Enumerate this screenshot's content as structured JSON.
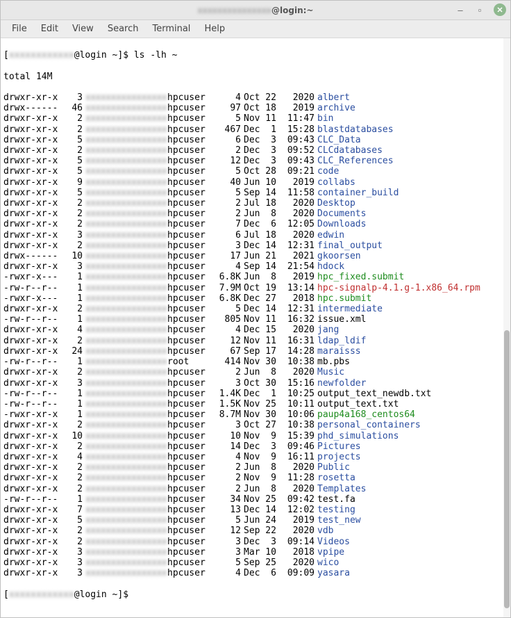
{
  "window": {
    "title_blurred": "xxxxxxxxxxxxxxx",
    "title_clear": "@login:~"
  },
  "menubar": [
    "File",
    "Edit",
    "View",
    "Search",
    "Terminal",
    "Help"
  ],
  "prompt": {
    "open": "[",
    "user_blurred": "xxxxxxxxxxxx",
    "host": "@login ~]$ ",
    "command": "ls -lh ~"
  },
  "total_line": "total 14M",
  "owner_placeholder": "xxxxxxxxxxxxxxxx",
  "listing": [
    {
      "perms": "drwxr-xr-x",
      "links": "3",
      "group": "hpcuser",
      "size": "4",
      "date": "Oct 22",
      "time": "2020",
      "name": "albert",
      "cls": "c-dir"
    },
    {
      "perms": "drwx------",
      "links": "46",
      "group": "hpcuser",
      "size": "97",
      "date": "Oct 18",
      "time": "2019",
      "name": "archive",
      "cls": "c-dir"
    },
    {
      "perms": "drwxr-xr-x",
      "links": "2",
      "group": "hpcuser",
      "size": "5",
      "date": "Nov 11",
      "time": "11:47",
      "name": "bin",
      "cls": "c-dir"
    },
    {
      "perms": "drwxr-xr-x",
      "links": "2",
      "group": "hpcuser",
      "size": "467",
      "date": "Dec  1",
      "time": "15:28",
      "name": "blastdatabases",
      "cls": "c-dir"
    },
    {
      "perms": "drwxr-xr-x",
      "links": "5",
      "group": "hpcuser",
      "size": "6",
      "date": "Dec  3",
      "time": "09:43",
      "name": "CLC_Data",
      "cls": "c-dir"
    },
    {
      "perms": "drwxr-xr-x",
      "links": "2",
      "group": "hpcuser",
      "size": "2",
      "date": "Dec  3",
      "time": "09:52",
      "name": "CLCdatabases",
      "cls": "c-dir"
    },
    {
      "perms": "drwxr-xr-x",
      "links": "5",
      "group": "hpcuser",
      "size": "12",
      "date": "Dec  3",
      "time": "09:43",
      "name": "CLC_References",
      "cls": "c-dir"
    },
    {
      "perms": "drwxr-xr-x",
      "links": "5",
      "group": "hpcuser",
      "size": "5",
      "date": "Oct 28",
      "time": "09:21",
      "name": "code",
      "cls": "c-dir"
    },
    {
      "perms": "drwxr-xr-x",
      "links": "9",
      "group": "hpcuser",
      "size": "40",
      "date": "Jun 10",
      "time": "2019",
      "name": "collabs",
      "cls": "c-dir"
    },
    {
      "perms": "drwxr-xr-x",
      "links": "5",
      "group": "hpcuser",
      "size": "5",
      "date": "Sep 14",
      "time": "11:58",
      "name": "container_build",
      "cls": "c-dir"
    },
    {
      "perms": "drwxr-xr-x",
      "links": "2",
      "group": "hpcuser",
      "size": "2",
      "date": "Jul 18",
      "time": "2020",
      "name": "Desktop",
      "cls": "c-dir"
    },
    {
      "perms": "drwxr-xr-x",
      "links": "2",
      "group": "hpcuser",
      "size": "2",
      "date": "Jun  8",
      "time": "2020",
      "name": "Documents",
      "cls": "c-dir"
    },
    {
      "perms": "drwxr-xr-x",
      "links": "2",
      "group": "hpcuser",
      "size": "7",
      "date": "Dec  6",
      "time": "12:05",
      "name": "Downloads",
      "cls": "c-dir"
    },
    {
      "perms": "drwxr-xr-x",
      "links": "3",
      "group": "hpcuser",
      "size": "6",
      "date": "Jul 18",
      "time": "2020",
      "name": "edwin",
      "cls": "c-dir"
    },
    {
      "perms": "drwxr-xr-x",
      "links": "2",
      "group": "hpcuser",
      "size": "3",
      "date": "Dec 14",
      "time": "12:31",
      "name": "final_output",
      "cls": "c-dir"
    },
    {
      "perms": "drwx------",
      "links": "10",
      "group": "hpcuser",
      "size": "17",
      "date": "Jun 21",
      "time": "2021",
      "name": "gkoorsen",
      "cls": "c-dir"
    },
    {
      "perms": "drwxr-xr-x",
      "links": "3",
      "group": "hpcuser",
      "size": "4",
      "date": "Sep 14",
      "time": "21:54",
      "name": "hdock",
      "cls": "c-dir"
    },
    {
      "perms": "-rwxr-x---",
      "links": "1",
      "group": "hpcuser",
      "size": "6.8K",
      "date": "Jun  8",
      "time": "2019",
      "name": "hpc_fixed.submit",
      "cls": "c-exec"
    },
    {
      "perms": "-rw-r--r--",
      "links": "1",
      "group": "hpcuser",
      "size": "7.9M",
      "date": "Oct 19",
      "time": "13:14",
      "name": "hpc-signalp-4.1.g-1.x86_64.rpm",
      "cls": "c-arch"
    },
    {
      "perms": "-rwxr-x---",
      "links": "1",
      "group": "hpcuser",
      "size": "6.8K",
      "date": "Dec 27",
      "time": "2018",
      "name": "hpc.submit",
      "cls": "c-exec"
    },
    {
      "perms": "drwxr-xr-x",
      "links": "2",
      "group": "hpcuser",
      "size": "5",
      "date": "Dec 14",
      "time": "12:31",
      "name": "intermediate",
      "cls": "c-dir"
    },
    {
      "perms": "-rw-r--r--",
      "links": "1",
      "group": "hpcuser",
      "size": "805",
      "date": "Nov 11",
      "time": "16:32",
      "name": "issue.xml",
      "cls": "c-plain"
    },
    {
      "perms": "drwxr-xr-x",
      "links": "4",
      "group": "hpcuser",
      "size": "4",
      "date": "Dec 15",
      "time": "2020",
      "name": "jang",
      "cls": "c-dir"
    },
    {
      "perms": "drwxr-xr-x",
      "links": "2",
      "group": "hpcuser",
      "size": "12",
      "date": "Nov 11",
      "time": "16:31",
      "name": "ldap_ldif",
      "cls": "c-dir"
    },
    {
      "perms": "drwxr-xr-x",
      "links": "24",
      "group": "hpcuser",
      "size": "67",
      "date": "Sep 17",
      "time": "14:28",
      "name": "maraisss",
      "cls": "c-dir"
    },
    {
      "perms": "-rw-r--r--",
      "links": "1",
      "group": "root",
      "size": "414",
      "date": "Nov 30",
      "time": "10:38",
      "name": "mb.pbs",
      "cls": "c-plain"
    },
    {
      "perms": "drwxr-xr-x",
      "links": "2",
      "group": "hpcuser",
      "size": "2",
      "date": "Jun  8",
      "time": "2020",
      "name": "Music",
      "cls": "c-dir"
    },
    {
      "perms": "drwxr-xr-x",
      "links": "3",
      "group": "hpcuser",
      "size": "3",
      "date": "Oct 30",
      "time": "15:16",
      "name": "newfolder",
      "cls": "c-dir"
    },
    {
      "perms": "-rw-r--r--",
      "links": "1",
      "group": "hpcuser",
      "size": "1.4K",
      "date": "Dec  1",
      "time": "10:25",
      "name": "output_text_newdb.txt",
      "cls": "c-plain"
    },
    {
      "perms": "-rw-r--r--",
      "links": "1",
      "group": "hpcuser",
      "size": "1.5K",
      "date": "Nov 25",
      "time": "10:11",
      "name": "output_text.txt",
      "cls": "c-plain"
    },
    {
      "perms": "-rwxr-xr-x",
      "links": "1",
      "group": "hpcuser",
      "size": "8.7M",
      "date": "Nov 30",
      "time": "10:06",
      "name": "paup4a168_centos64",
      "cls": "c-exec"
    },
    {
      "perms": "drwxr-xr-x",
      "links": "2",
      "group": "hpcuser",
      "size": "3",
      "date": "Oct 27",
      "time": "10:38",
      "name": "personal_containers",
      "cls": "c-dir"
    },
    {
      "perms": "drwxr-xr-x",
      "links": "10",
      "group": "hpcuser",
      "size": "10",
      "date": "Nov  9",
      "time": "15:39",
      "name": "phd_simulations",
      "cls": "c-dir"
    },
    {
      "perms": "drwxr-xr-x",
      "links": "2",
      "group": "hpcuser",
      "size": "14",
      "date": "Dec  3",
      "time": "09:46",
      "name": "Pictures",
      "cls": "c-dir"
    },
    {
      "perms": "drwxr-xr-x",
      "links": "4",
      "group": "hpcuser",
      "size": "4",
      "date": "Nov  9",
      "time": "16:11",
      "name": "projects",
      "cls": "c-dir"
    },
    {
      "perms": "drwxr-xr-x",
      "links": "2",
      "group": "hpcuser",
      "size": "2",
      "date": "Jun  8",
      "time": "2020",
      "name": "Public",
      "cls": "c-dir"
    },
    {
      "perms": "drwxr-xr-x",
      "links": "2",
      "group": "hpcuser",
      "size": "2",
      "date": "Nov  9",
      "time": "11:28",
      "name": "rosetta",
      "cls": "c-dir"
    },
    {
      "perms": "drwxr-xr-x",
      "links": "2",
      "group": "hpcuser",
      "size": "2",
      "date": "Jun  8",
      "time": "2020",
      "name": "Templates",
      "cls": "c-dir"
    },
    {
      "perms": "-rw-r--r--",
      "links": "1",
      "group": "hpcuser",
      "size": "34",
      "date": "Nov 25",
      "time": "09:42",
      "name": "test.fa",
      "cls": "c-plain"
    },
    {
      "perms": "drwxr-xr-x",
      "links": "7",
      "group": "hpcuser",
      "size": "13",
      "date": "Dec 14",
      "time": "12:02",
      "name": "testing",
      "cls": "c-dir"
    },
    {
      "perms": "drwxr-xr-x",
      "links": "5",
      "group": "hpcuser",
      "size": "5",
      "date": "Jun 24",
      "time": "2019",
      "name": "test_new",
      "cls": "c-dir"
    },
    {
      "perms": "drwxr-xr-x",
      "links": "2",
      "group": "hpcuser",
      "size": "12",
      "date": "Sep 22",
      "time": "2020",
      "name": "vdb",
      "cls": "c-dir"
    },
    {
      "perms": "drwxr-xr-x",
      "links": "2",
      "group": "hpcuser",
      "size": "3",
      "date": "Dec  3",
      "time": "09:14",
      "name": "Videos",
      "cls": "c-dir"
    },
    {
      "perms": "drwxr-xr-x",
      "links": "3",
      "group": "hpcuser",
      "size": "3",
      "date": "Mar 10",
      "time": "2018",
      "name": "vpipe",
      "cls": "c-dir"
    },
    {
      "perms": "drwxr-xr-x",
      "links": "3",
      "group": "hpcuser",
      "size": "5",
      "date": "Sep 25",
      "time": "2020",
      "name": "wico",
      "cls": "c-dir"
    },
    {
      "perms": "drwxr-xr-x",
      "links": "3",
      "group": "hpcuser",
      "size": "4",
      "date": "Dec  6",
      "time": "09:09",
      "name": "yasara",
      "cls": "c-dir"
    }
  ],
  "prompt2": {
    "open": "[",
    "user_blurred": "xxxxxxxxxxxx",
    "host": "@login ~]$ "
  }
}
